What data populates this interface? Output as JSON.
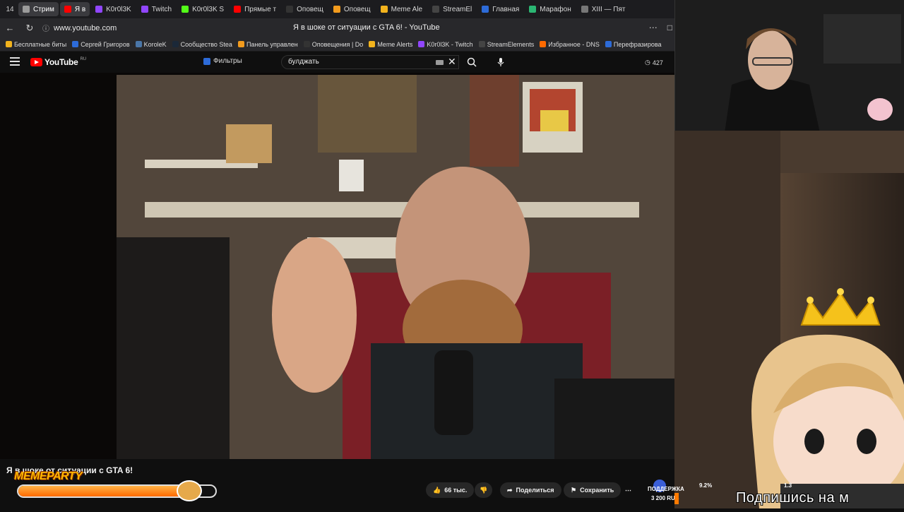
{
  "browser": {
    "tab_count": "14",
    "tabs": [
      {
        "label": "Стрим",
        "color": "#9b9b9b",
        "active": true
      },
      {
        "label": "Я в",
        "color": "#ff0000",
        "active": true
      },
      {
        "label": "K0r0l3K",
        "color": "#9146ff"
      },
      {
        "label": "Twitch",
        "color": "#9146ff"
      },
      {
        "label": "K0r0l3K S",
        "color": "#53fc18"
      },
      {
        "label": "Прямые т",
        "color": "#ff0000"
      },
      {
        "label": "Оповещ",
        "color": "#333333"
      },
      {
        "label": "Оповещ",
        "color": "#f29b1d"
      },
      {
        "label": "Meme Ale",
        "color": "#f2b31d"
      },
      {
        "label": "StreamEl",
        "color": "#444444"
      },
      {
        "label": "Главная",
        "color": "#2d6bd8"
      },
      {
        "label": "Марафон",
        "color": "#2bb673"
      },
      {
        "label": "XIII — Пят",
        "color": "#777777"
      }
    ],
    "url": "www.youtube.com",
    "page_title": "Я в шоке от ситуации с GTA 6! - YouTube",
    "bookmarks": [
      {
        "label": "Бесплатные биты",
        "color": "#f2b31d"
      },
      {
        "label": "Сергей Григоров",
        "color": "#2d6bd8"
      },
      {
        "label": "KoroleK",
        "color": "#4a76a8"
      },
      {
        "label": "Сообщество Stea",
        "color": "#1b2838"
      },
      {
        "label": "Панель управлен",
        "color": "#f29b1d"
      },
      {
        "label": "Оповещения | Do",
        "color": "#333333"
      },
      {
        "label": "Meme Alerts",
        "color": "#f2b31d"
      },
      {
        "label": "K0r0l3K - Twitch",
        "color": "#9146ff"
      },
      {
        "label": "StreamElements",
        "color": "#444444"
      },
      {
        "label": "Избранное - DNS",
        "color": "#ff6a00"
      },
      {
        "label": "Перефразирова",
        "color": "#2d6bd8"
      }
    ]
  },
  "youtube": {
    "logo_text": "YouTube",
    "logo_region": "RU",
    "filters_label": "Фильтры",
    "search_value": "булджать",
    "viewers": "427",
    "video_title": "Я в шоке от ситуации с GTA 6!",
    "like_count": "66 тыс.",
    "share_label": "Поделиться",
    "save_label": "Сохранить"
  },
  "stream_overlay": {
    "memeparty_label": "MEMEPARTY",
    "memeparty_progress": 0.82,
    "support_label": "ПОДДЕРЖКА",
    "support_amount": "3 200 RUB",
    "support_pct": "9.2%",
    "support_pct2": "1.3",
    "subscribe_text": "Подпишись на м"
  }
}
